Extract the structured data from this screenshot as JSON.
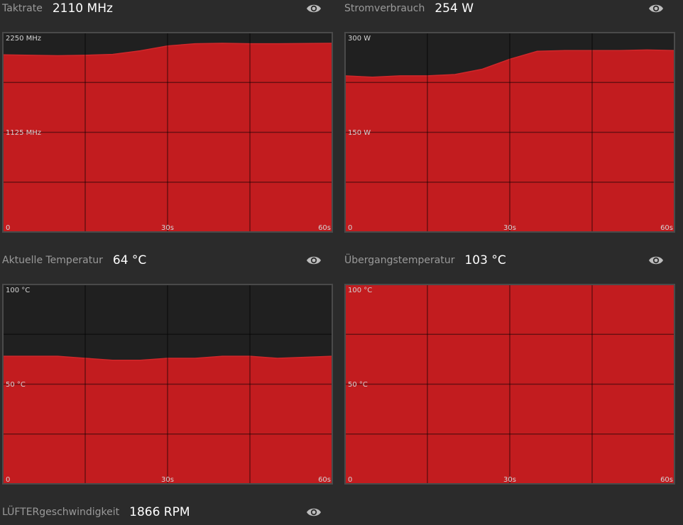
{
  "colors": {
    "background": "#2b2b2b",
    "plot_bg": "#202020",
    "fill": "#c21c1f",
    "line": "#d0272a",
    "grid": "#4a4a4a"
  },
  "icons": {
    "visibility": "eye-icon"
  },
  "panels": [
    {
      "id": "clock",
      "label": "Taktrate",
      "value": "2110 MHz"
    },
    {
      "id": "power",
      "label": "Stromverbrauch",
      "value": "254 W"
    },
    {
      "id": "temp",
      "label": "Aktuelle Temperatur",
      "value": "64 °C"
    },
    {
      "id": "junction",
      "label": "Übergangstemperatur",
      "value": "103 °C"
    },
    {
      "id": "fan",
      "label": "LÜFTERgeschwindigkeit",
      "value": "1866 RPM"
    }
  ],
  "chart_data": [
    {
      "type": "area",
      "series": [
        {
          "values": [
            2000,
            1995,
            1990,
            1995,
            2005,
            2045,
            2100,
            2125,
            2130,
            2125,
            2125,
            2130
          ]
        }
      ],
      "x": [
        0,
        5,
        10,
        15,
        20,
        25,
        30,
        35,
        40,
        45,
        50,
        60
      ],
      "ylim": [
        0,
        2250
      ],
      "xlim": [
        0,
        60
      ],
      "y_tick_labels": [
        "2250 MHz",
        "1125 MHz",
        "0"
      ],
      "x_tick_labels": [
        "30s",
        "60s"
      ],
      "grid": true
    },
    {
      "type": "area",
      "series": [
        {
          "values": [
            235,
            233,
            235,
            235,
            237,
            245,
            260,
            272,
            273,
            273,
            273,
            274,
            273
          ]
        }
      ],
      "x": [
        0,
        5,
        10,
        15,
        20,
        25,
        30,
        35,
        40,
        45,
        50,
        55,
        60
      ],
      "ylim": [
        0,
        300
      ],
      "xlim": [
        0,
        60
      ],
      "y_tick_labels": [
        "300 W",
        "150 W",
        "0"
      ],
      "x_tick_labels": [
        "30s",
        "60s"
      ],
      "grid": true
    },
    {
      "type": "area",
      "series": [
        {
          "values": [
            64,
            64,
            64,
            63,
            62,
            62,
            63,
            63,
            64,
            64,
            63,
            64
          ]
        }
      ],
      "x": [
        0,
        5,
        10,
        15,
        20,
        25,
        30,
        35,
        40,
        45,
        50,
        60
      ],
      "ylim": [
        0,
        100
      ],
      "xlim": [
        0,
        60
      ],
      "y_tick_labels": [
        "100 °C",
        "50 °C",
        "0"
      ],
      "x_tick_labels": [
        "30s",
        "60s"
      ],
      "grid": true
    },
    {
      "type": "area",
      "series": [
        {
          "values": [
            100,
            100
          ]
        }
      ],
      "x": [
        0,
        60
      ],
      "ylim": [
        0,
        100
      ],
      "xlim": [
        0,
        60
      ],
      "y_tick_labels": [
        "100 °C",
        "50 °C",
        "0"
      ],
      "x_tick_labels": [
        "30s",
        "60s"
      ],
      "grid": true
    }
  ]
}
